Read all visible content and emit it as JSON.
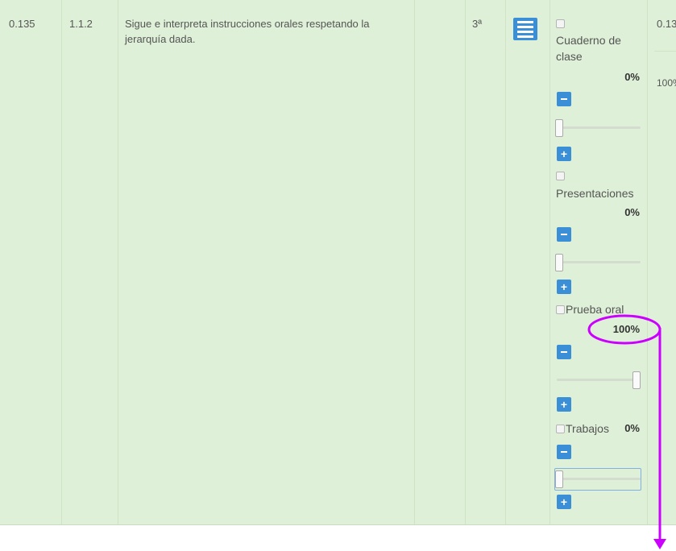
{
  "row": {
    "weight": "0.135",
    "code": "1.1.2",
    "description": "Sigue e interpreta instrucciones orales respetando la jerarquía dada.",
    "trimester": "3ª",
    "next_weight": "0.13",
    "next_percent": "100%"
  },
  "instruments": [
    {
      "label": "Cuaderno de clase",
      "percent": "0%",
      "value": 0
    },
    {
      "label": "Presentaciones",
      "percent": "0%",
      "value": 0
    },
    {
      "label": "Prueba oral",
      "percent": "100%",
      "value": 100
    },
    {
      "label": "Trabajos",
      "percent": "0%",
      "value": 0
    }
  ],
  "buttons": {
    "minus": "−",
    "plus": "+"
  },
  "colors": {
    "row_bg": "#dff0d8",
    "button": "#3a8fd6",
    "annotation": "#cc00ff"
  },
  "icons": {
    "menu": "hamburger-menu-icon"
  }
}
